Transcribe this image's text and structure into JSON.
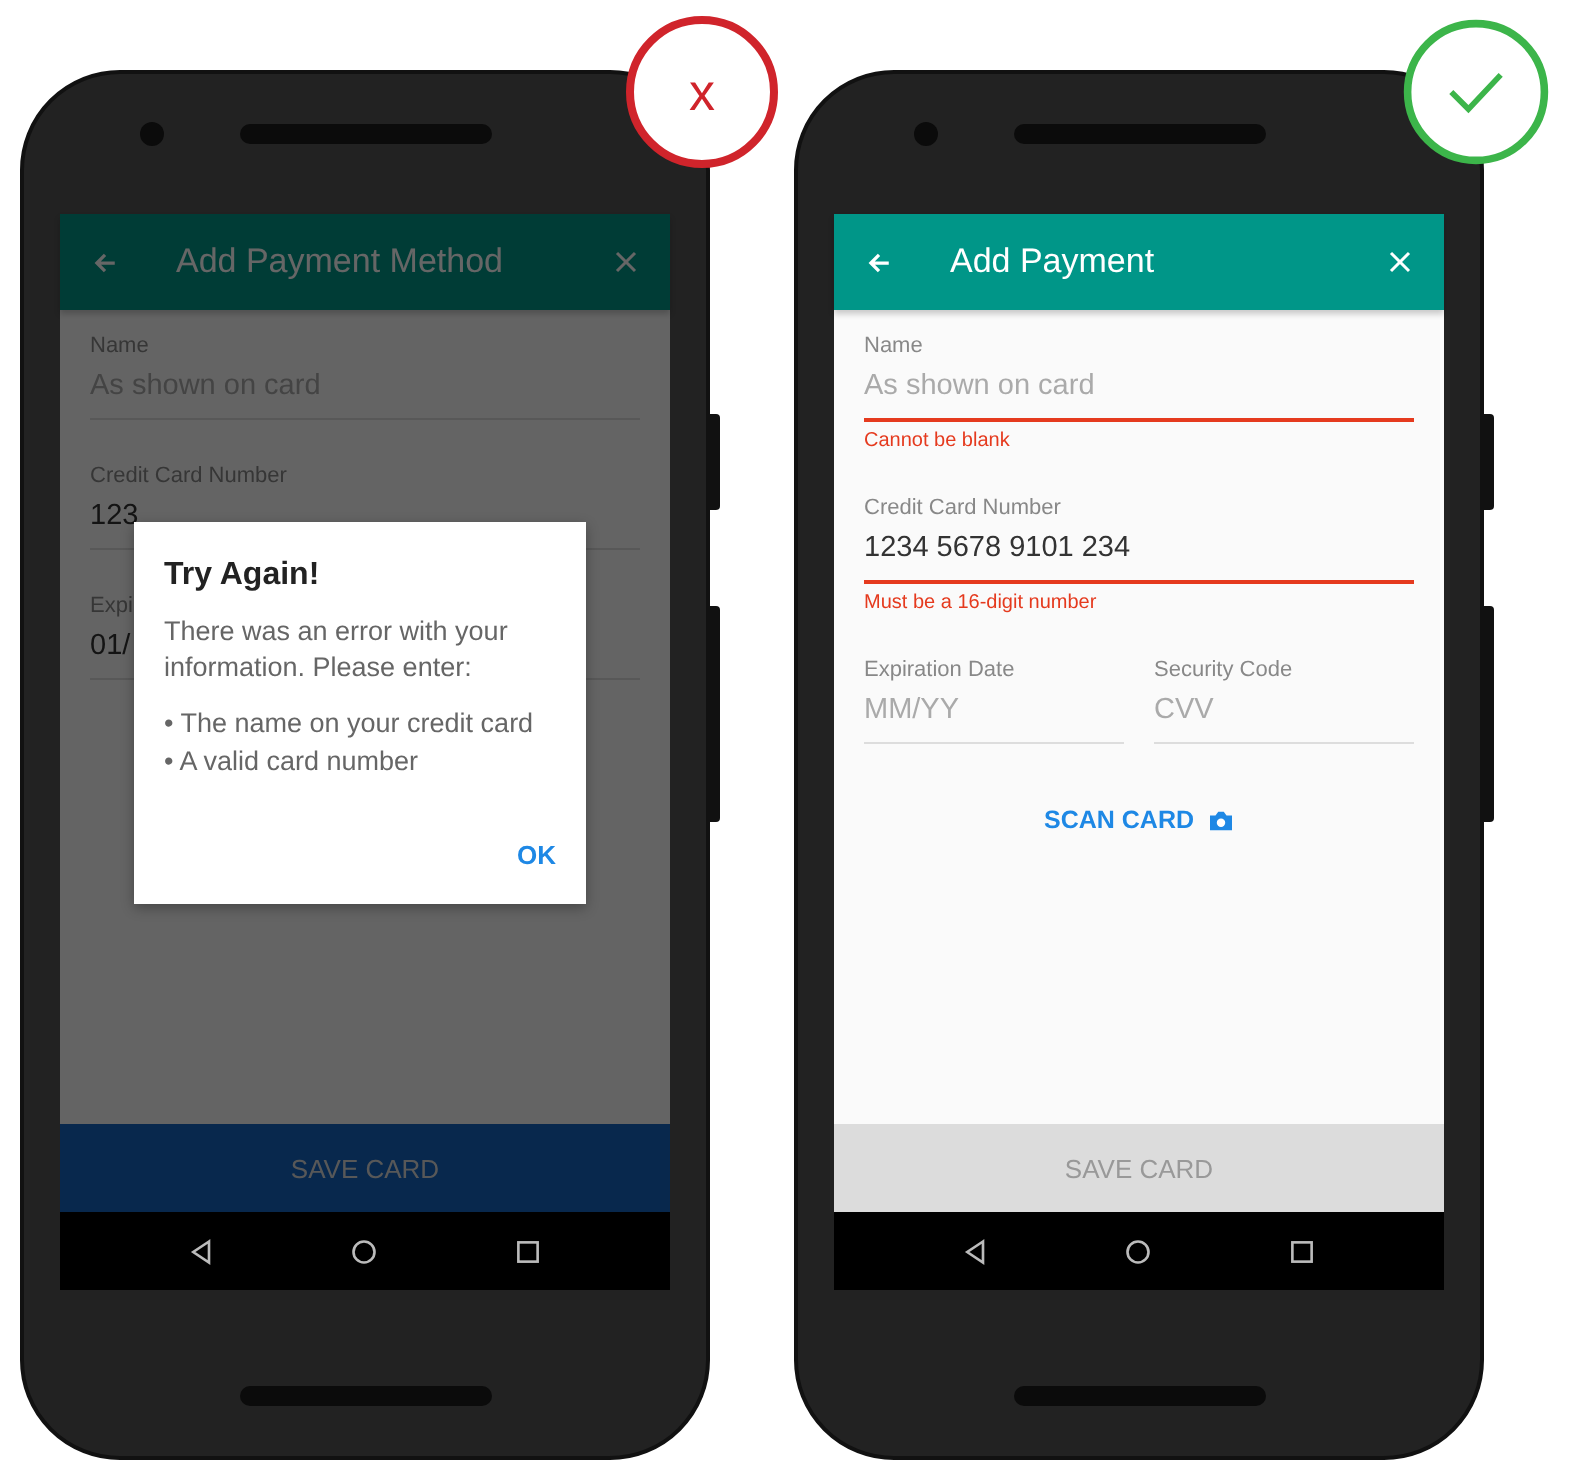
{
  "examples": [
    {
      "kind": "wrong",
      "mark": "x",
      "screen": {
        "dimmed": true,
        "title": "Add Payment Method",
        "rows": [
          [
            {
              "label": "Name",
              "placeholder": "As shown on card"
            }
          ],
          [
            {
              "label": "Credit Card Number",
              "value": "123"
            }
          ],
          [
            {
              "label": "Expi",
              "value": "01/"
            }
          ]
        ],
        "save_button": {
          "label": "SAVE CARD",
          "disabled": false
        },
        "dialog": {
          "title": "Try Again!",
          "message": "There was an error with your information. Please enter:",
          "bullets": [
            "• The name on your credit card",
            "• A valid card number"
          ],
          "button": "OK"
        }
      }
    },
    {
      "kind": "right",
      "screen": {
        "dimmed": false,
        "title": "Add Payment",
        "rows": [
          [
            {
              "label": "Name",
              "placeholder": "As shown on card",
              "error": "Cannot be blank"
            }
          ],
          [
            {
              "label": "Credit Card Number",
              "value": "1234 5678 9101 234",
              "error": "Must be a 16-digit number"
            }
          ],
          [
            {
              "label": "Expiration Date",
              "placeholder": "MM/YY"
            },
            {
              "label": "Security Code",
              "placeholder": "CVV"
            }
          ]
        ],
        "scan_link": "SCAN CARD",
        "save_button": {
          "label": "SAVE CARD",
          "disabled": true
        }
      }
    }
  ]
}
